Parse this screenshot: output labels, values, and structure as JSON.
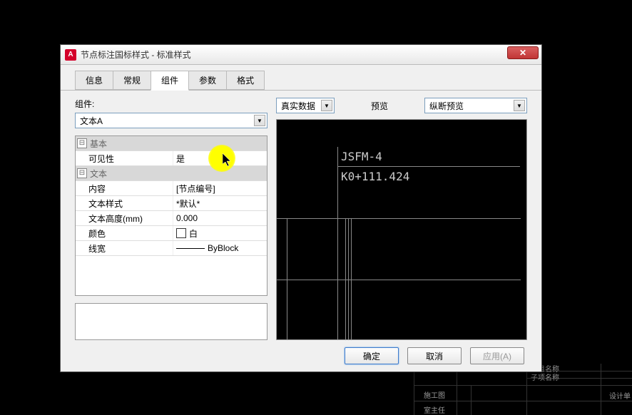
{
  "window": {
    "title": "节点标注国标样式 - 标准样式"
  },
  "tabs": {
    "items": [
      {
        "label": "信息",
        "active": false
      },
      {
        "label": "常规",
        "active": false
      },
      {
        "label": "组件",
        "active": true
      },
      {
        "label": "参数",
        "active": false
      },
      {
        "label": "格式",
        "active": false
      }
    ]
  },
  "left": {
    "label": "组件:",
    "combo_value": "文本A"
  },
  "properties": {
    "groups": [
      {
        "name": "基本",
        "rows": [
          {
            "name": "可见性",
            "value": "是"
          }
        ]
      },
      {
        "name": "文本",
        "rows": [
          {
            "name": "内容",
            "value": "[节点编号]"
          },
          {
            "name": "文本样式",
            "value": "*默认*"
          },
          {
            "name": "文本高度(mm)",
            "value": "0.000"
          },
          {
            "name": "颜色",
            "value": "白",
            "swatch": true
          },
          {
            "name": "线宽",
            "value": "ByBlock",
            "line": true
          }
        ]
      }
    ]
  },
  "right": {
    "data_combo": "真实数据",
    "preview_label": "预览",
    "section_combo": "纵断预览"
  },
  "preview": {
    "line1": "JSFM-4",
    "line2": "K0+111.424"
  },
  "buttons": {
    "ok": "确定",
    "cancel": "取消",
    "apply": "应用(A)"
  },
  "bg": {
    "col1": "项目名称",
    "col2": "子项名称",
    "col3": "设计单",
    "row1": "施工图",
    "row2": "室主任"
  }
}
